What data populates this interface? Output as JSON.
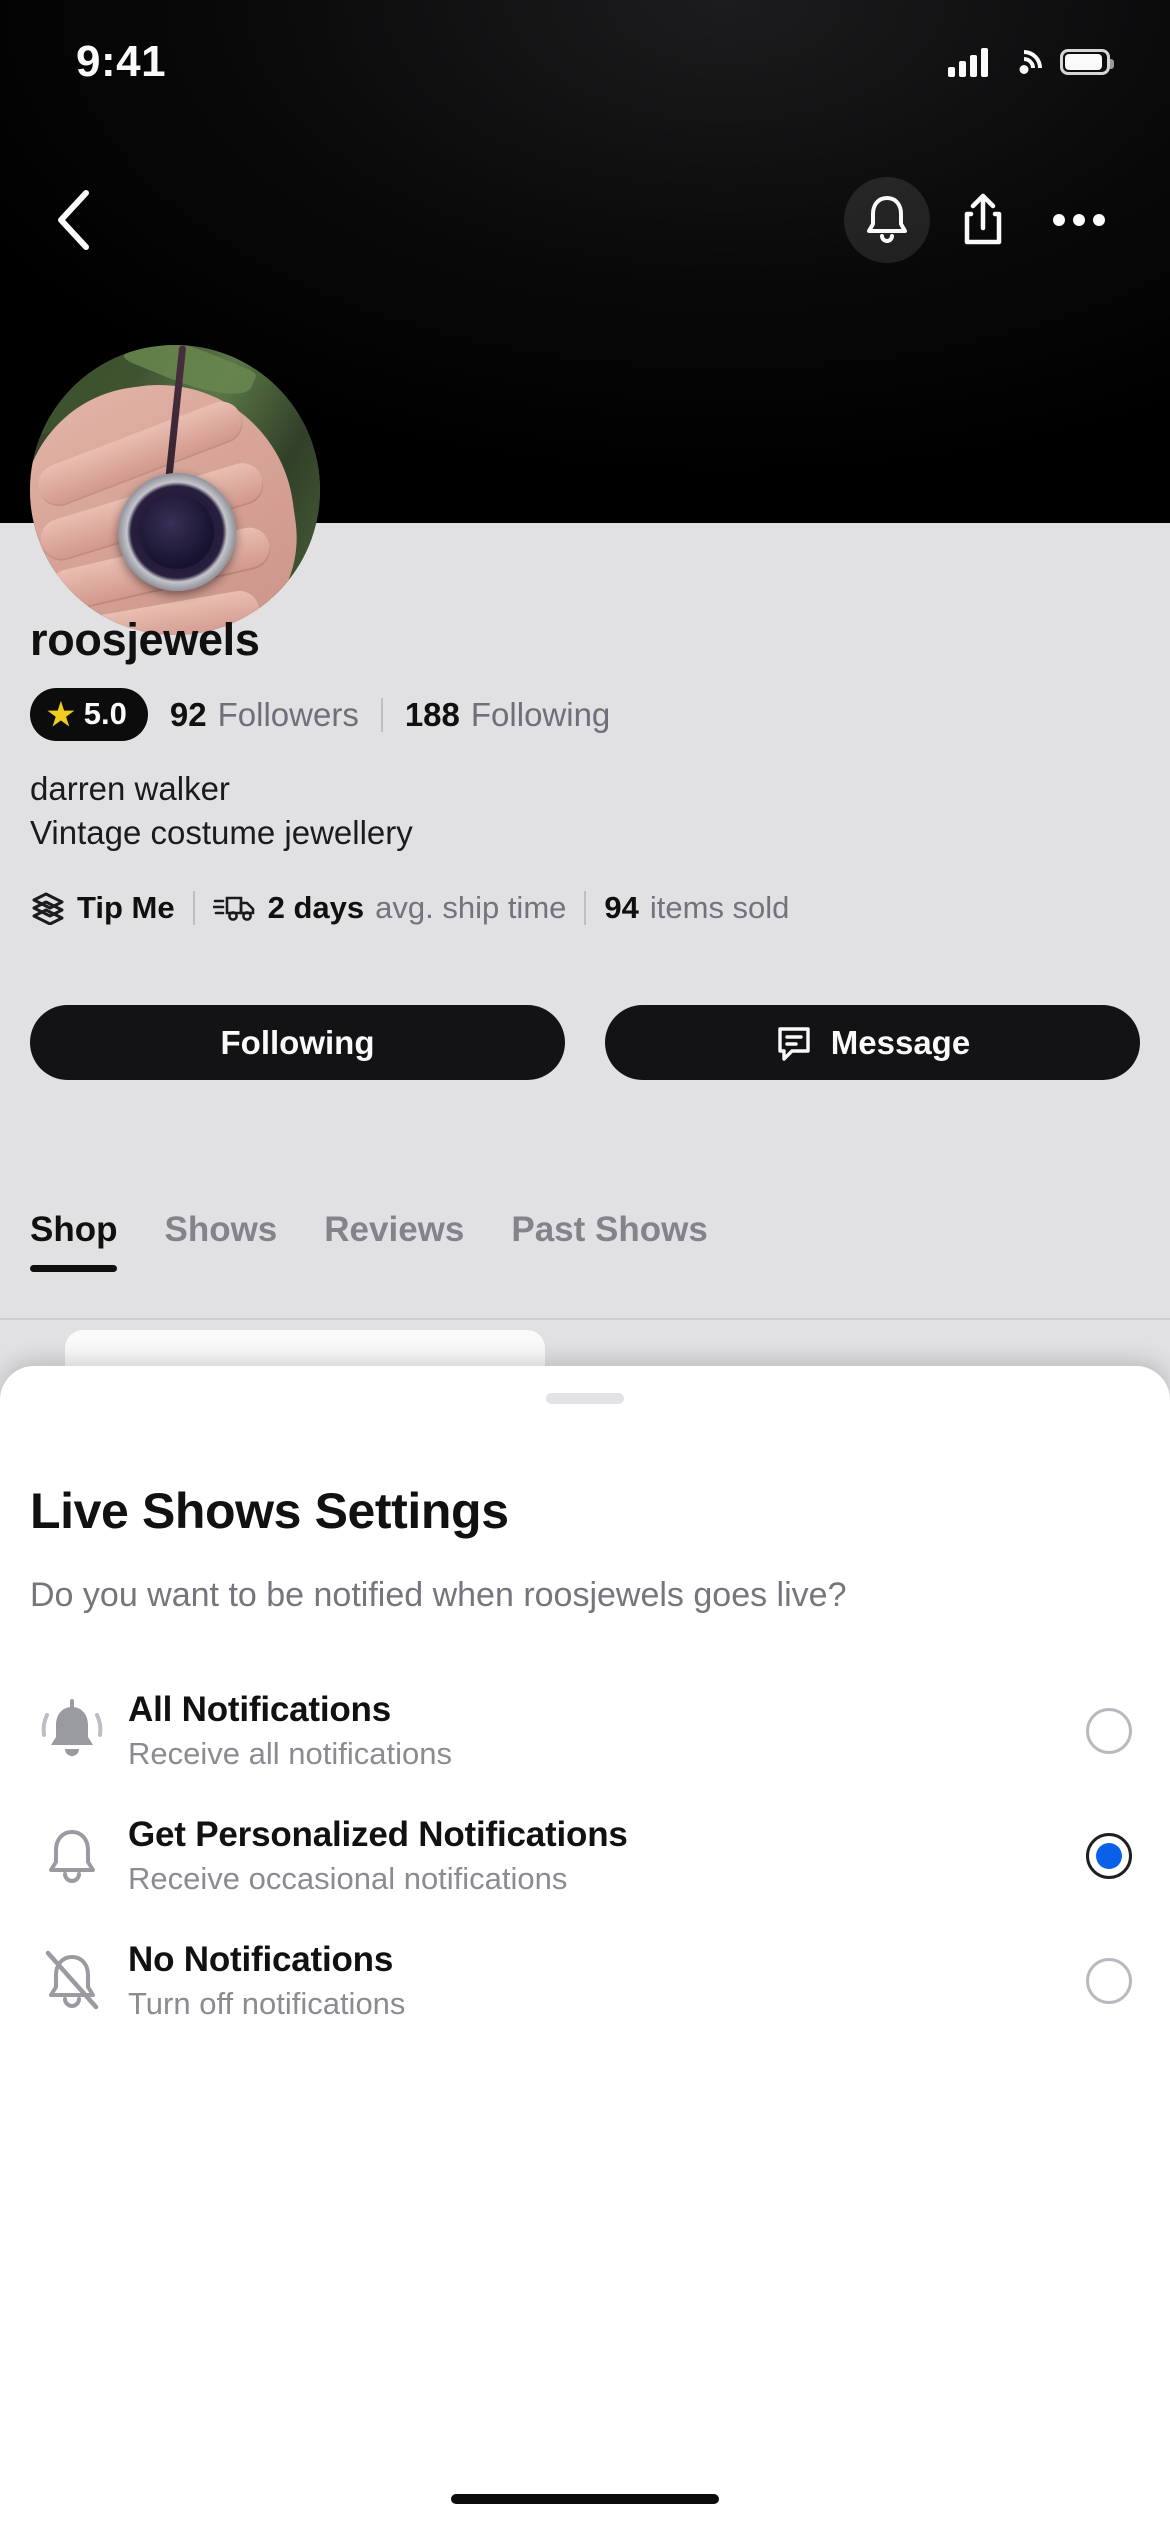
{
  "status_bar": {
    "time": "9:41",
    "icons": [
      "cellular-signal-icon",
      "wifi-icon",
      "battery-icon"
    ]
  },
  "nav_bar": {
    "back_icon": "chevron-left-icon",
    "bell_icon": "bell-icon",
    "share_icon": "share-icon",
    "more_icon": "ellipsis-icon"
  },
  "profile": {
    "avatar_alt": "hand holding a round pendant necklace over green foliage",
    "username": "roosjewels",
    "rating": "5.0",
    "star_glyph": "★",
    "followers_count": "92",
    "followers_label": "Followers",
    "following_count": "188",
    "following_label": "Following",
    "handle": "darren walker",
    "bio": "Vintage costume jewellery",
    "meta": {
      "tip_icon": "tip-bill-icon",
      "tip_label": "Tip Me",
      "ship_icon": "truck-icon",
      "ship_value": "2 days",
      "ship_label": "avg. ship time",
      "items_value": "94",
      "items_label": "items sold"
    },
    "actions": {
      "follow_label": "Following",
      "message_label": "Message",
      "message_icon": "chat-bubble-icon"
    },
    "tabs": [
      {
        "label": "Shop",
        "active": true
      },
      {
        "label": "Shows",
        "active": false
      },
      {
        "label": "Reviews",
        "active": false
      },
      {
        "label": "Past Shows",
        "active": false
      }
    ]
  },
  "sheet": {
    "title": "Live Shows Settings",
    "subtitle": "Do you want to be notified when roosjewels goes live?",
    "options": [
      {
        "icon": "bell-ringing-filled-icon",
        "title": "All Notifications",
        "desc": "Receive all notifications",
        "selected": false
      },
      {
        "icon": "bell-outline-icon",
        "title": "Get Personalized Notifications",
        "desc": "Receive occasional notifications",
        "selected": true
      },
      {
        "icon": "bell-slash-icon",
        "title": "No Notifications",
        "desc": "Turn off notifications",
        "selected": false
      }
    ]
  },
  "colors": {
    "accent_blue": "#0a60e8",
    "star_yellow": "#f5d21e",
    "dark": "#141416",
    "page_bg": "#e6e6e9"
  }
}
